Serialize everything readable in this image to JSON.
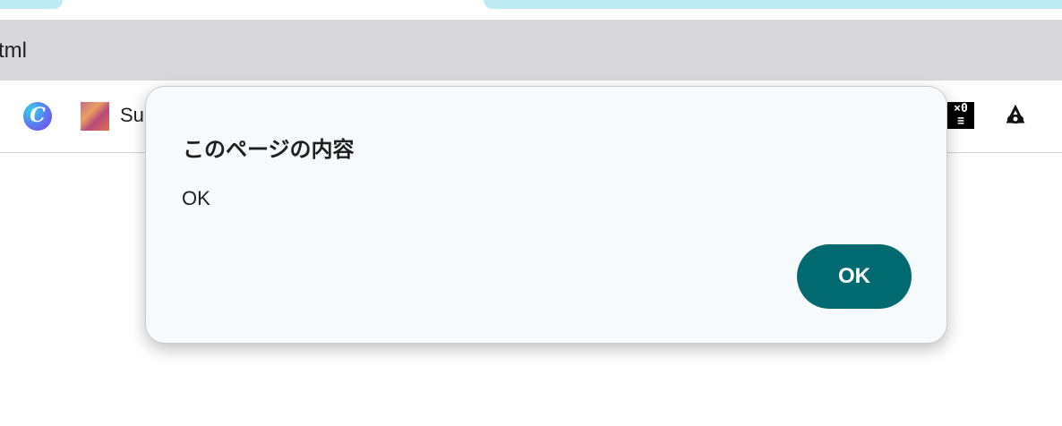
{
  "browser": {
    "url_fragment": "tml",
    "bookmarks": [
      {
        "icon": "canva-icon",
        "label": ""
      },
      {
        "icon": "thumbnail-icon",
        "label": "Su"
      },
      {
        "icon": "x-logo-icon",
        "label": ""
      },
      {
        "icon": "eye-icon",
        "label": ""
      }
    ]
  },
  "dialog": {
    "title": "このページの内容",
    "message": "OK",
    "ok_label": "OK",
    "accent_color": "#006a70"
  }
}
